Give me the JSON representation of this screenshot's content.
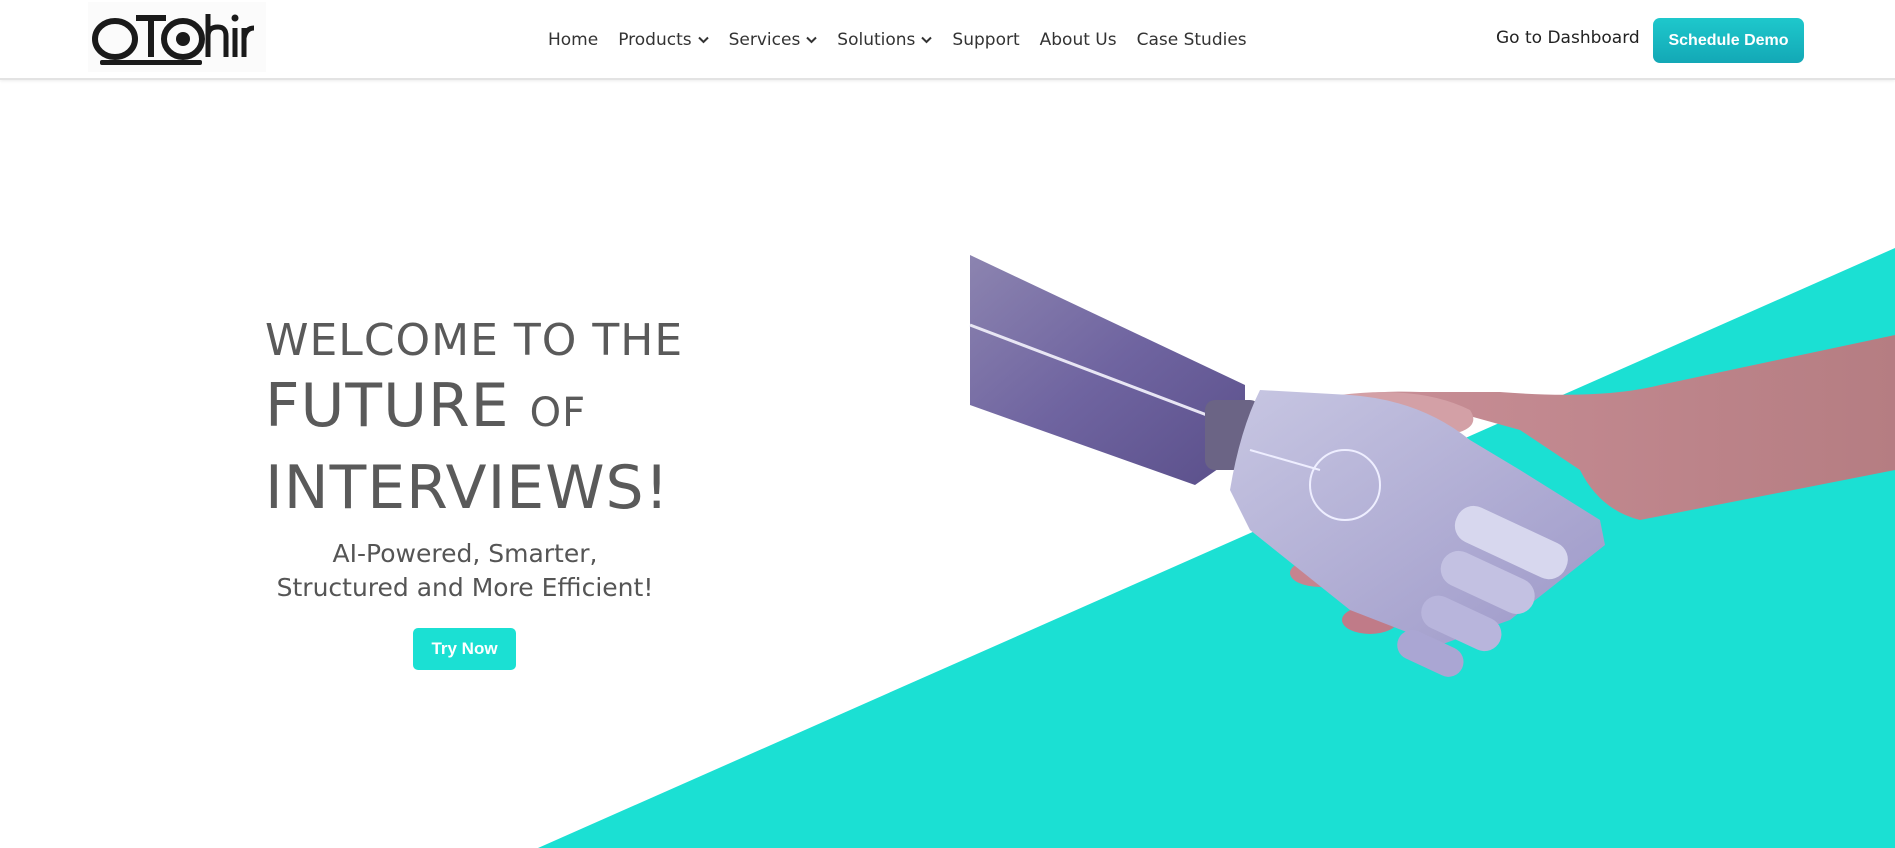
{
  "brand": {
    "logo_text": "OTOhire",
    "accent_color": "#1be0d3",
    "button_gradient": [
      "#1ec8cc",
      "#13a8b6"
    ]
  },
  "nav": {
    "items": [
      {
        "label": "Home",
        "has_dropdown": false
      },
      {
        "label": "Products",
        "has_dropdown": true
      },
      {
        "label": "Services",
        "has_dropdown": true
      },
      {
        "label": "Solutions",
        "has_dropdown": true
      },
      {
        "label": "Support",
        "has_dropdown": false
      },
      {
        "label": "About Us",
        "has_dropdown": false
      },
      {
        "label": "Case Studies",
        "has_dropdown": false
      }
    ],
    "dashboard_label": "Go to Dashboard",
    "schedule_label": "Schedule Demo"
  },
  "hero": {
    "line1": "WELCOME TO THE",
    "line2_main": "FUTURE",
    "line2_small": "OF",
    "line3": "INTERVIEWS!",
    "subtitle_line1": "AI-Powered, Smarter,",
    "subtitle_line2": "Structured and More Efficient!",
    "cta_label": "Try Now",
    "image": "robot-human-handshake"
  },
  "icons": {
    "dropdown": "chevron-down-icon"
  }
}
